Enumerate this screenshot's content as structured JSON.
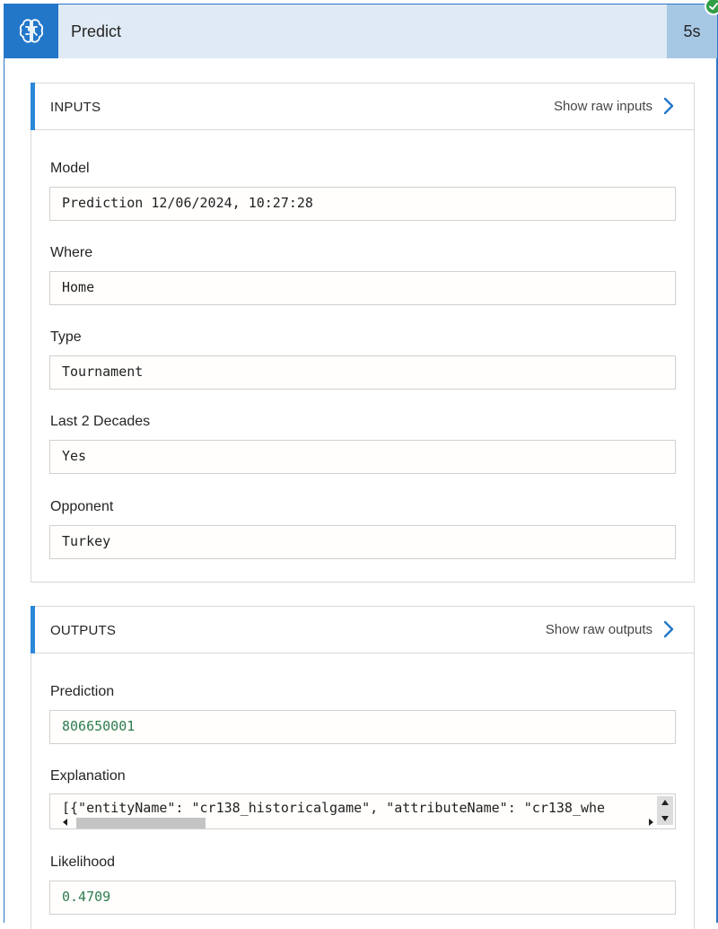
{
  "header": {
    "title": "Predict",
    "duration": "5s",
    "icon": "brain-icon",
    "status_icon": "check-circle-icon",
    "accent_color": "#2277c9",
    "status_color": "#2f9e44"
  },
  "inputs": {
    "title": "INPUTS",
    "raw_link_label": "Show raw inputs",
    "fields": [
      {
        "label": "Model",
        "value": "Prediction 12/06/2024, 10:27:28"
      },
      {
        "label": "Where",
        "value": "Home"
      },
      {
        "label": "Type",
        "value": "Tournament"
      },
      {
        "label": "Last 2 Decades",
        "value": "Yes"
      },
      {
        "label": "Opponent",
        "value": "Turkey"
      }
    ]
  },
  "outputs": {
    "title": "OUTPUTS",
    "raw_link_label": "Show raw outputs",
    "fields": [
      {
        "label": "Prediction",
        "value": "806650001"
      },
      {
        "label": "Explanation",
        "value": "[{\"entityName\": \"cr138_historicalgame\", \"attributeName\": \"cr138_whe"
      },
      {
        "label": "Likelihood",
        "value": "0.4709"
      }
    ]
  }
}
